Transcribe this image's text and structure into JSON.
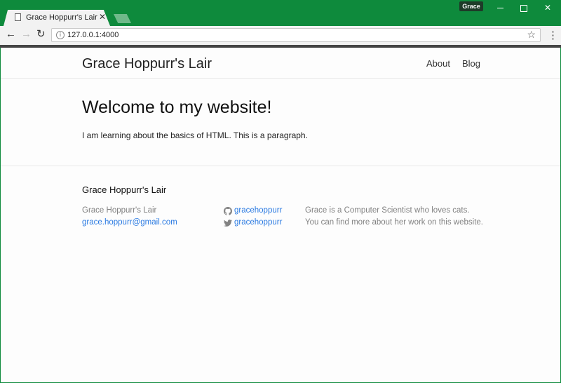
{
  "browser": {
    "tab_title": "Grace Hoppurr's Lair",
    "url": "127.0.0.1:4000",
    "profile_name": "Grace"
  },
  "site": {
    "title": "Grace Hoppurr's Lair",
    "nav": [
      {
        "label": "About"
      },
      {
        "label": "Blog"
      }
    ]
  },
  "main": {
    "heading": "Welcome to my website!",
    "paragraph": "I am learning about the basics of HTML. This is a paragraph."
  },
  "footer": {
    "heading": "Grace Hoppurr's Lair",
    "name": "Grace Hoppurr's Lair",
    "email": "grace.hoppurr@gmail.com",
    "github": {
      "username": "gracehoppurr",
      "icon": "github-icon"
    },
    "twitter": {
      "username": "gracehoppurr",
      "icon": "twitter-icon"
    },
    "description_line1": "Grace is a Computer Scientist who loves cats.",
    "description_line2": "You can find more about her work on this website."
  },
  "colors": {
    "chrome_frame": "#0e8a3c",
    "link": "#2a7ae2"
  }
}
